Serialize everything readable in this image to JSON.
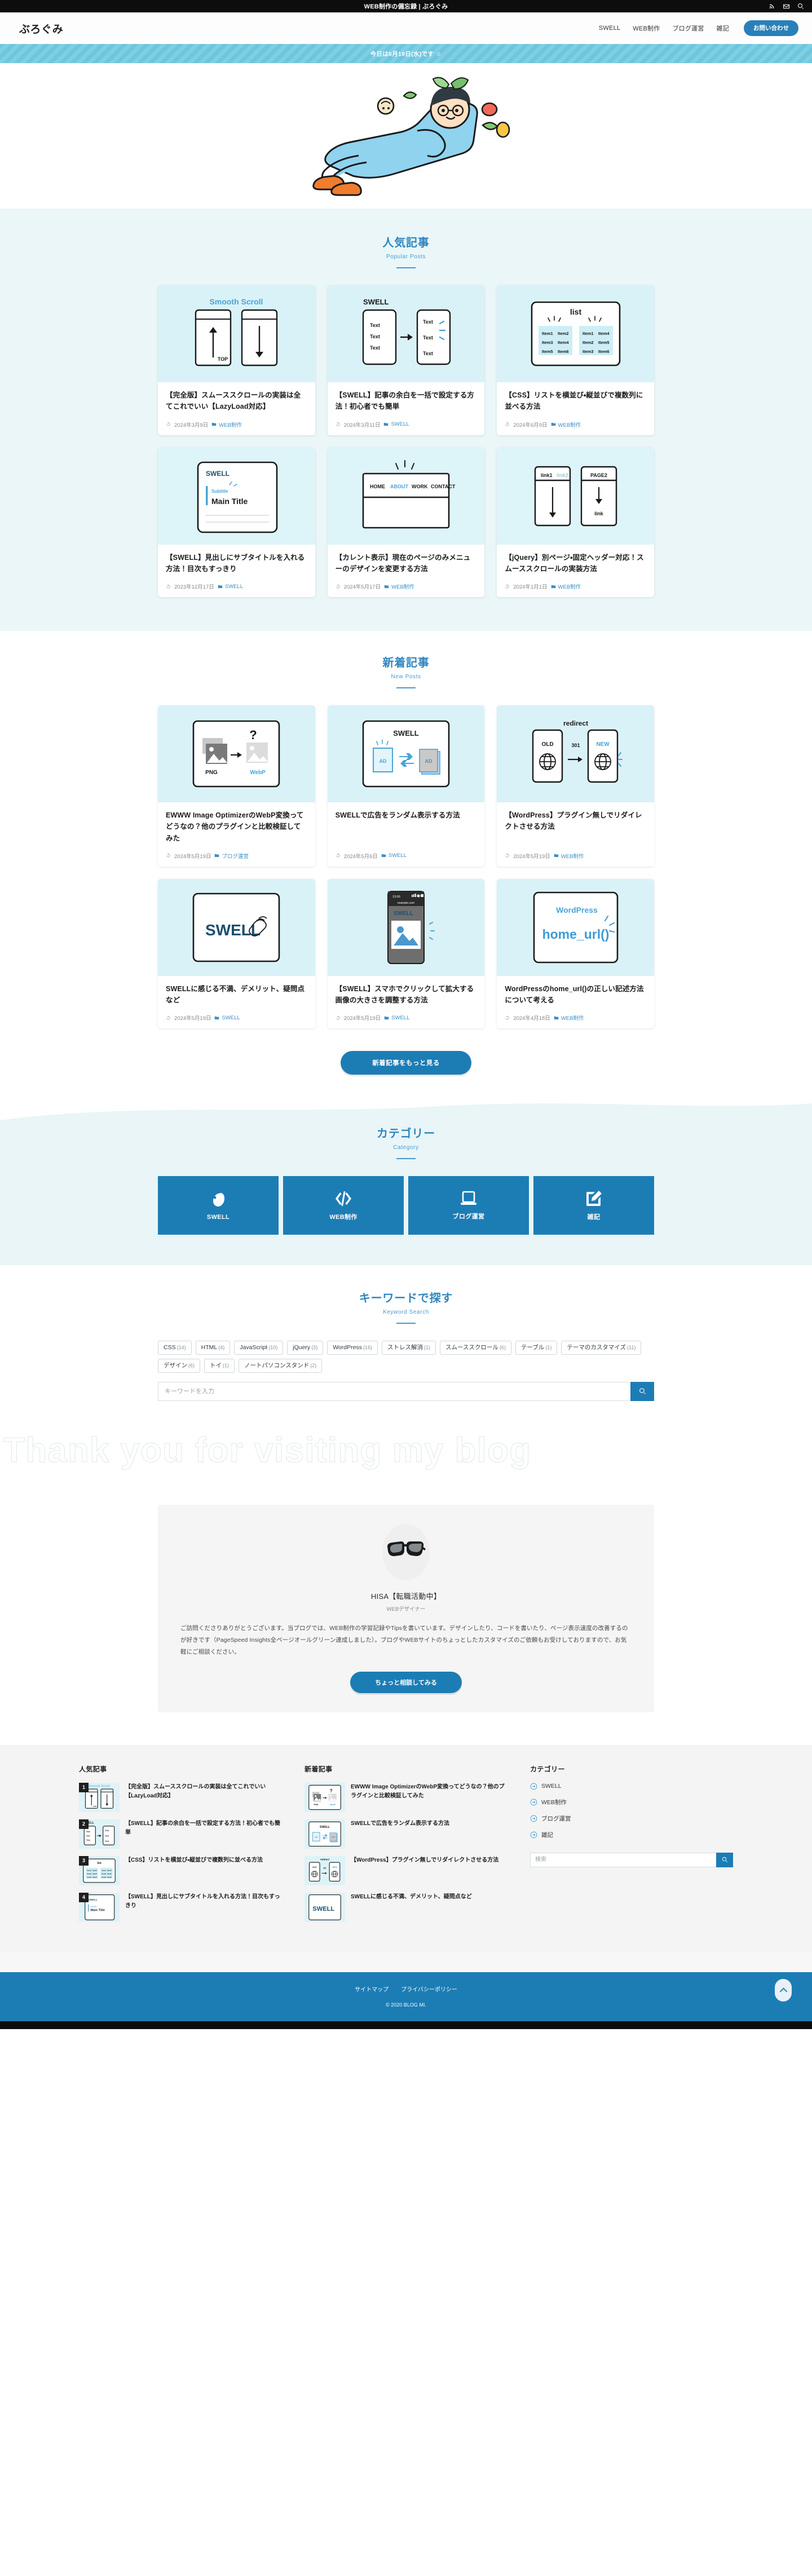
{
  "topbar": {
    "title": "WEB制作の備忘録 | ぶろぐみ",
    "icons": [
      "rss-icon",
      "mail-icon",
      "search-icon"
    ]
  },
  "header": {
    "logo": "ぶろぐみ",
    "nav": [
      {
        "label": "SWELL"
      },
      {
        "label": "WEB制作"
      },
      {
        "label": "ブログ運営"
      },
      {
        "label": "雑記"
      }
    ],
    "contact_label": "お問い合わせ"
  },
  "notice": {
    "text": "今日は6月19日(水)です ☺"
  },
  "popular": {
    "heading_ja": "人気記事",
    "heading_en": "Popular Posts",
    "posts": [
      {
        "thumb": "smooth-scroll",
        "title": "【完全版】スムーススクロールの実装は全てこれでいい【LazyLoad対応】",
        "date": "2024年3月9日",
        "category": "WEB制作"
      },
      {
        "thumb": "swell-margin",
        "title": "【SWELL】記事の余白を一括で設定する方法！初心者でも簡単",
        "date": "2024年3月11日",
        "category": "SWELL"
      },
      {
        "thumb": "css-list",
        "title": "【CSS】リストを横並び・縦並びで複数列に並べる方法",
        "date": "2024年6月9日",
        "category": "WEB制作"
      },
      {
        "thumb": "swell-subtitle",
        "title": "【SWELL】見出しにサブタイトルを入れる方法！目次もすっきり",
        "date": "2023年12月17日",
        "category": "SWELL"
      },
      {
        "thumb": "current-menu",
        "title": "【カレント表示】現在のページのみメニューのデザインを変更する方法",
        "date": "2024年5月17日",
        "category": "WEB制作"
      },
      {
        "thumb": "jquery-scroll",
        "title": "【jQuery】別ページ・固定ヘッダー対応！スムーススクロールの実装方法",
        "date": "2024年1月1日",
        "category": "WEB制作"
      }
    ]
  },
  "newposts": {
    "heading_ja": "新着記事",
    "heading_en": "New Posts",
    "more_label": "新着記事をもっと見る",
    "posts": [
      {
        "thumb": "webp",
        "title": "EWWW Image OptimizerのWebP変換ってどうなの？他のプラグインと比較検証してみた",
        "date": "2024年5月19日",
        "category": "ブログ運営"
      },
      {
        "thumb": "swell-ad",
        "title": "SWELLで広告をランダム表示する方法",
        "date": "2024年5月6日",
        "category": "SWELL"
      },
      {
        "thumb": "redirect",
        "title": "【WordPress】プラグイン無しでリダイレクトさせる方法",
        "date": "2024年5月19日",
        "category": "WEB制作"
      },
      {
        "thumb": "swell-hand",
        "title": "SWELLに感じる不満、デメリット、疑問点など",
        "date": "2024年5月19日",
        "category": "SWELL"
      },
      {
        "thumb": "phone-img",
        "title": "【SWELL】スマホでクリックして拡大する画像の大きさを調整する方法",
        "date": "2024年5月19日",
        "category": "SWELL"
      },
      {
        "thumb": "home-url",
        "title": "WordPressのhome_url()の正しい記述方法について考える",
        "date": "2024年4月18日",
        "category": "WEB制作"
      }
    ]
  },
  "category": {
    "heading_ja": "カテゴリー",
    "heading_en": "Category",
    "tiles": [
      {
        "icon": "swell-drop-icon",
        "label": "SWELL"
      },
      {
        "icon": "code-icon",
        "label": "WEB制作"
      },
      {
        "icon": "laptop-icon",
        "label": "ブログ運営"
      },
      {
        "icon": "pencil-note-icon",
        "label": "雑記"
      }
    ]
  },
  "keyword": {
    "heading_ja": "キーワードで探す",
    "heading_en": "Keyword Search",
    "tags": [
      {
        "label": "CSS",
        "count": "(14)"
      },
      {
        "label": "HTML",
        "count": "(4)"
      },
      {
        "label": "JavaScript",
        "count": "(10)"
      },
      {
        "label": "jQuery",
        "count": "(3)"
      },
      {
        "label": "WordPress",
        "count": "(16)"
      },
      {
        "label": "ストレス解消",
        "count": "(1)"
      },
      {
        "label": "スムーススクロール",
        "count": "(6)"
      },
      {
        "label": "テーブル",
        "count": "(1)"
      },
      {
        "label": "テーマのカスタマイズ",
        "count": "(11)"
      },
      {
        "label": "デザイン",
        "count": "(6)"
      },
      {
        "label": "トイ",
        "count": "(1)"
      },
      {
        "label": "ノートパソコンスタンド",
        "count": "(2)"
      }
    ],
    "search_placeholder": "キーワードを入力",
    "search_value": "",
    "search_button_icon": "search-icon"
  },
  "watermark": {
    "text": "Thank you for visiting my blog"
  },
  "profile": {
    "avatar_icon": "glasses-photo",
    "name": "HISA【転職活動中】",
    "role": "WEBデザイナー",
    "bio": "ご訪問くださりありがとうございます。当ブログでは、WEB制作の学習記録やTipsを書いています。デザインしたり、コードを書いたり、ページ表示速度の改善するのが好きです（PageSpeed Insights全ページオールグリーン達成しました）。ブログやWEBサイトのちょっとしたカスタマイズのご依頼もお受けしておりますので、お気軽にご相談ください。",
    "button_label": "ちょっと相談してみる"
  },
  "footer_widgets": {
    "popular": {
      "title": "人気記事",
      "items": [
        {
          "rank": "1",
          "thumb": "smooth-scroll",
          "title": "【完全版】スムーススクロールの実装は全てこれでいい【LazyLoad対応】"
        },
        {
          "rank": "2",
          "thumb": "swell-margin",
          "title": "【SWELL】記事の余白を一括で設定する方法！初心者でも簡単"
        },
        {
          "rank": "3",
          "thumb": "css-list",
          "title": "【CSS】リストを横並び・縦並びで複数列に並べる方法"
        },
        {
          "rank": "4",
          "thumb": "swell-subtitle",
          "title": "【SWELL】見出しにサブタイトルを入れる方法！目次もすっきり"
        }
      ]
    },
    "newposts": {
      "title": "新着記事",
      "items": [
        {
          "thumb": "webp",
          "title": "EWWW Image OptimizerのWebP変換ってどうなの？他のプラグインと比較検証してみた"
        },
        {
          "thumb": "swell-ad",
          "title": "SWELLで広告をランダム表示する方法"
        },
        {
          "thumb": "redirect",
          "title": "【WordPress】プラグイン無しでリダイレクトさせる方法"
        },
        {
          "thumb": "swell-hand",
          "title": "SWELLに感じる不満、デメリット、疑問点など"
        }
      ]
    },
    "category": {
      "title": "カテゴリー",
      "items": [
        {
          "label": "SWELL"
        },
        {
          "label": "WEB制作"
        },
        {
          "label": "ブログ運営"
        },
        {
          "label": "雑記"
        }
      ],
      "search_placeholder": "検索",
      "search_value": ""
    }
  },
  "footer": {
    "links": [
      {
        "label": "サイトマップ"
      },
      {
        "label": "プライバシーポリシー"
      }
    ],
    "copyright": "© 2020 BLOG MI.",
    "totop_icon": "chevron-up-icon"
  },
  "colors": {
    "accent": "#1c7db5",
    "nav_accent": "#2980b9",
    "heading": "#2e86c1",
    "pale": "#eaf6f7",
    "thumb_bg": "#d9f2f7",
    "black": "#0d0d0d"
  }
}
